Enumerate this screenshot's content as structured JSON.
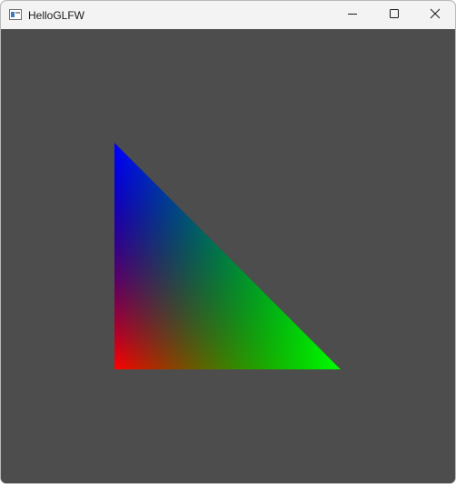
{
  "window": {
    "title": "HelloGLFW",
    "icon": "window-app-icon",
    "controls": {
      "minimize_icon": "minimize-icon",
      "maximize_icon": "maximize-icon",
      "close_icon": "close-icon"
    }
  },
  "viewport": {
    "clear_color": "#4d4d4d",
    "triangle": {
      "vertex_colors": {
        "top_left": "#0000ff",
        "bottom_left": "#ff0000",
        "bottom_right": "#00ff00"
      }
    }
  }
}
